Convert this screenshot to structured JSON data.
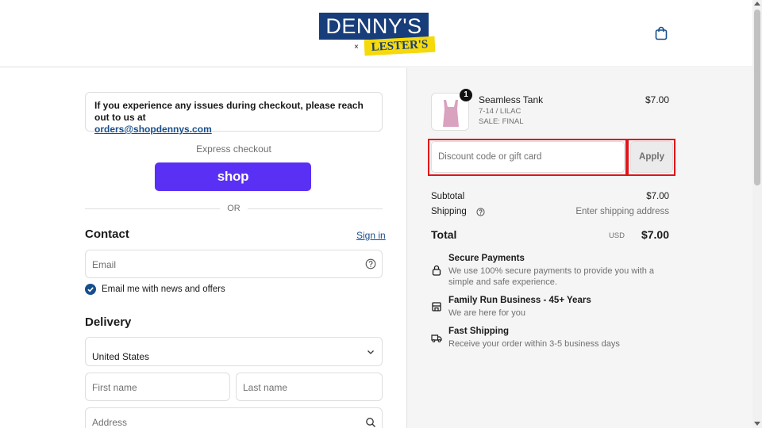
{
  "brand": {
    "top": "DENNY'S",
    "x": "×",
    "bottom": "LESTER'S"
  },
  "notice": {
    "text": "If you experience any issues during checkout, please reach out to us at",
    "email": "orders@shopdennys.com"
  },
  "express": {
    "label": "Express checkout",
    "shop_label": "shop",
    "or": "OR"
  },
  "contact": {
    "title": "Contact",
    "signin": "Sign in",
    "email_placeholder": "Email",
    "newsletter_label": "Email me with news and offers",
    "newsletter_checked": true
  },
  "delivery": {
    "title": "Delivery",
    "country": "United States",
    "first_name_placeholder": "First name",
    "last_name_placeholder": "Last name",
    "address_placeholder": "Address"
  },
  "cart": {
    "quantity": "1",
    "product_name": "Seamless Tank",
    "variant": "7-14 / LILAC",
    "sale": "SALE: FINAL",
    "price": "$7.00",
    "product_color": "#d9a2bf"
  },
  "discount": {
    "placeholder": "Discount code or gift card",
    "apply_label": "Apply"
  },
  "summary": {
    "subtotal_label": "Subtotal",
    "subtotal_value": "$7.00",
    "shipping_label": "Shipping",
    "shipping_value": "Enter shipping address",
    "total_label": "Total",
    "currency": "USD",
    "total_value": "$7.00"
  },
  "features": [
    {
      "title": "Secure Payments",
      "desc": "We use 100% secure payments to provide you with a simple and safe experience.",
      "icon": "lock-icon"
    },
    {
      "title": "Family Run Business - 45+ Years",
      "desc": "We are here for you",
      "icon": "store-icon"
    },
    {
      "title": "Fast Shipping",
      "desc": "Receive your order within 3-5 business days",
      "icon": "truck-icon"
    }
  ],
  "colors": {
    "accent": "#174e8c",
    "shop": "#5a31f4",
    "highlight": "#e0151b"
  }
}
